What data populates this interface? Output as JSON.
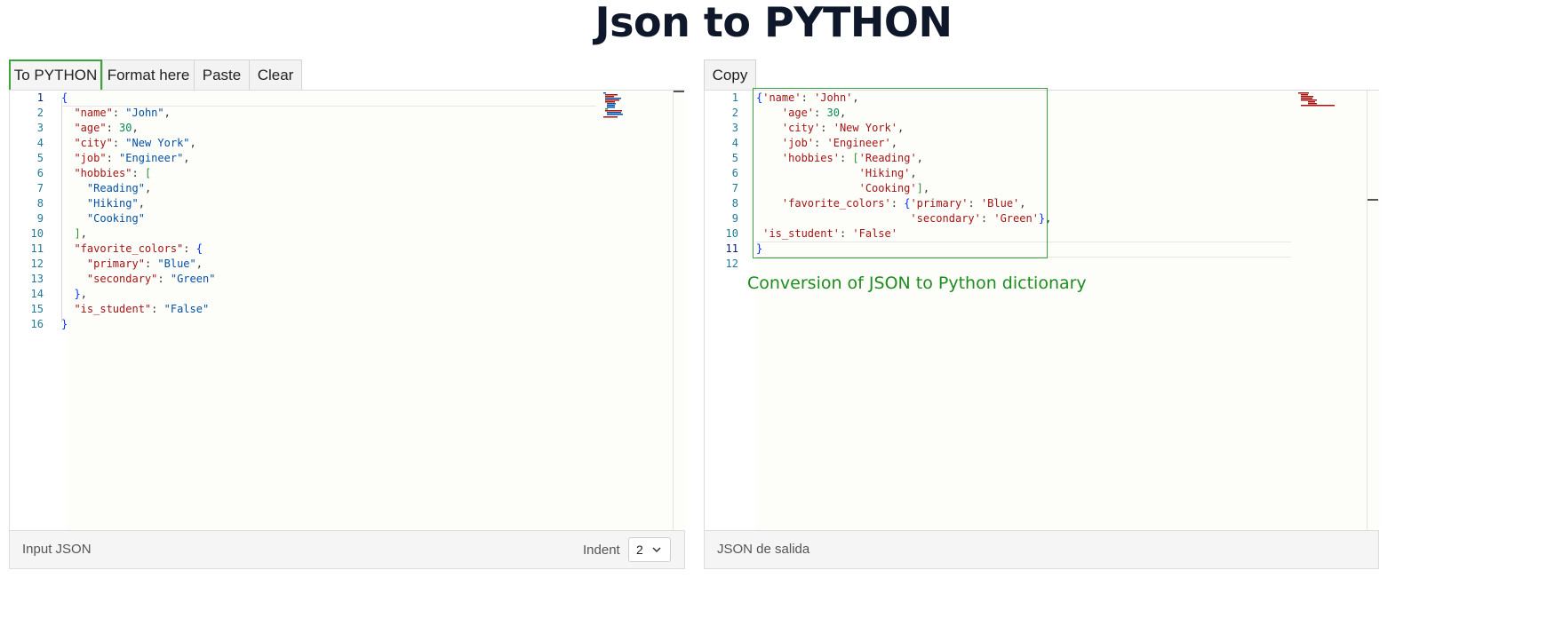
{
  "page": {
    "title": "Json to PYTHON"
  },
  "left_toolbar": {
    "to_python": "To PYTHON",
    "format": "Format here",
    "paste": "Paste",
    "clear": "Clear"
  },
  "right_toolbar": {
    "copy": "Copy"
  },
  "input_editor": {
    "line_numbers": [
      "1",
      "2",
      "3",
      "4",
      "5",
      "6",
      "7",
      "8",
      "9",
      "10",
      "11",
      "12",
      "13",
      "14",
      "15",
      "16"
    ],
    "lines": [
      "{",
      "  \"name\": \"John\",",
      "  \"age\": 30,",
      "  \"city\": \"New York\",",
      "  \"job\": \"Engineer\",",
      "  \"hobbies\": [",
      "    \"Reading\",",
      "    \"Hiking\",",
      "    \"Cooking\"",
      "  ],",
      "  \"favorite_colors\": {",
      "    \"primary\": \"Blue\",",
      "    \"secondary\": \"Green\"",
      "  },",
      "  \"is_student\": \"False\"",
      "}"
    ],
    "footer_label": "Input JSON",
    "indent_label": "Indent",
    "indent_value": "2"
  },
  "output_editor": {
    "line_numbers": [
      "1",
      "2",
      "3",
      "4",
      "5",
      "6",
      "7",
      "8",
      "9",
      "10",
      "11",
      "12"
    ],
    "lines": [
      "{'name': 'John',",
      "    'age': 30,",
      "    'city': 'New York',",
      "    'job': 'Engineer',",
      "    'hobbies': ['Reading',",
      "                'Hiking',",
      "                'Cooking'],",
      "    'favorite_colors': {'primary': 'Blue',",
      "                        'secondary': 'Green'},",
      " 'is_student': 'False'",
      "}",
      ""
    ],
    "footer_label": "JSON de salida",
    "annotation": "Conversion of JSON to Python dictionary"
  },
  "colors": {
    "accent_green": "#3aa63a",
    "key_red": "#a31515",
    "string_blue": "#0451a5",
    "number_green": "#098658",
    "line_number": "#237893"
  }
}
